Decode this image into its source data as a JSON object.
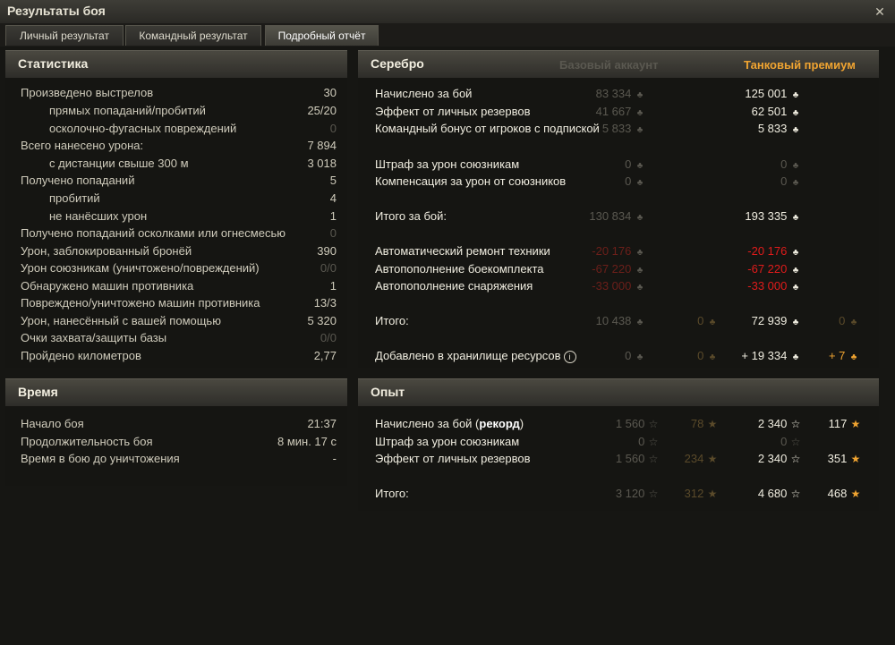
{
  "window": {
    "title": "Результаты боя",
    "close": "✕"
  },
  "tabs": [
    "Личный результат",
    "Командный результат",
    "Подробный отчёт"
  ],
  "stats": {
    "title": "Статистика",
    "rows": [
      {
        "label": "Произведено выстрелов",
        "value": "30"
      },
      {
        "label": "прямых попаданий/пробитий",
        "value": "25/20"
      },
      {
        "label": "осколочно-фугасных повреждений",
        "value": "0"
      },
      {
        "label": "Всего нанесено урона:",
        "value": "7 894"
      },
      {
        "label": "с дистанции свыше 300 м",
        "value": "3 018"
      },
      {
        "label": "Получено попаданий",
        "value": "5"
      },
      {
        "label": "пробитий",
        "value": "4"
      },
      {
        "label": "не нанёсших урон",
        "value": "1"
      },
      {
        "label": "Получено попаданий осколками или огнесмесью",
        "value": "0"
      },
      {
        "label": "Урон, заблокированный бронёй",
        "value": "390"
      },
      {
        "label": "Урон союзникам (уничтожено/повреждений)",
        "value": "0/0"
      },
      {
        "label": "Обнаружено машин противника",
        "value": "1"
      },
      {
        "label": "Повреждено/уничтожено машин противника",
        "value": "13/3"
      },
      {
        "label": "Урон, нанесённый с вашей помощью",
        "value": "5 320"
      },
      {
        "label": "Очки захвата/защиты базы",
        "value": "0/0"
      },
      {
        "label": "Пройдено километров",
        "value": "2,77"
      }
    ]
  },
  "time": {
    "title": "Время",
    "rows": [
      {
        "label": "Начало боя",
        "value": "21:37"
      },
      {
        "label": "Продолжительность боя",
        "value": "8 мин. 17 с"
      },
      {
        "label": "Время в бою до уничтожения",
        "value": "-"
      }
    ]
  },
  "silver": {
    "title": "Серебро",
    "col_basic": "Базовый аккаунт",
    "col_premium": "Танковый премиум",
    "rows": [
      {
        "label": "Начислено за бой",
        "basic": "83 334",
        "premium": "125 001"
      },
      {
        "label": "Эффект от личных резервов",
        "basic": "41 667",
        "premium": "62 501"
      },
      {
        "label": "Командный бонус от игроков с подпиской",
        "basic": "5 833",
        "premium": "5 833"
      },
      {
        "label": "Штраф за урон союзникам",
        "basic": "0",
        "premium": "0"
      },
      {
        "label": "Компенсация за урон от союзников",
        "basic": "0",
        "premium": "0"
      },
      {
        "label": "Итого за бой:",
        "basic": "130 834",
        "premium": "193 335"
      },
      {
        "label": "Автоматический ремонт техники",
        "basic": "-20 176",
        "premium": "-20 176"
      },
      {
        "label": "Автопополнение боекомплекта",
        "basic": "-67 220",
        "premium": "-67 220"
      },
      {
        "label": "Автопополнение снаряжения",
        "basic": "-33 000",
        "premium": "-33 000"
      },
      {
        "label": "Итого:",
        "basic": "10 438",
        "basic_gold": "0",
        "premium": "72 939",
        "premium_gold": "0"
      },
      {
        "label": "Добавлено в хранилище ресурсов",
        "basic": "0",
        "basic_gold": "0",
        "premium": "+ 19 334",
        "premium_gold": "+ 7"
      }
    ]
  },
  "xp": {
    "title": "Опыт",
    "rows": [
      {
        "label": "Начислено за бой (",
        "label_bold": "рекорд",
        "label_end": ")",
        "basic": "1 560",
        "basic_free": "78",
        "premium": "2 340",
        "premium_free": "117"
      },
      {
        "label": "Штраф за урон союзникам",
        "basic": "0",
        "premium": "0"
      },
      {
        "label": "Эффект от личных резервов",
        "basic": "1 560",
        "basic_free": "234",
        "premium": "2 340",
        "premium_free": "351"
      },
      {
        "label": "Итого:",
        "basic": "3 120",
        "basic_free": "312",
        "premium": "4 680",
        "premium_free": "468"
      }
    ]
  },
  "icons": {
    "credit": "♣",
    "gold": "♣",
    "xp": "☆",
    "free_xp": "★",
    "info": "i"
  },
  "colors": {
    "credit": "#c8c6bb",
    "gold": "#f0a431",
    "negative": "#e01b1b",
    "premium_header": "#f0a431"
  }
}
